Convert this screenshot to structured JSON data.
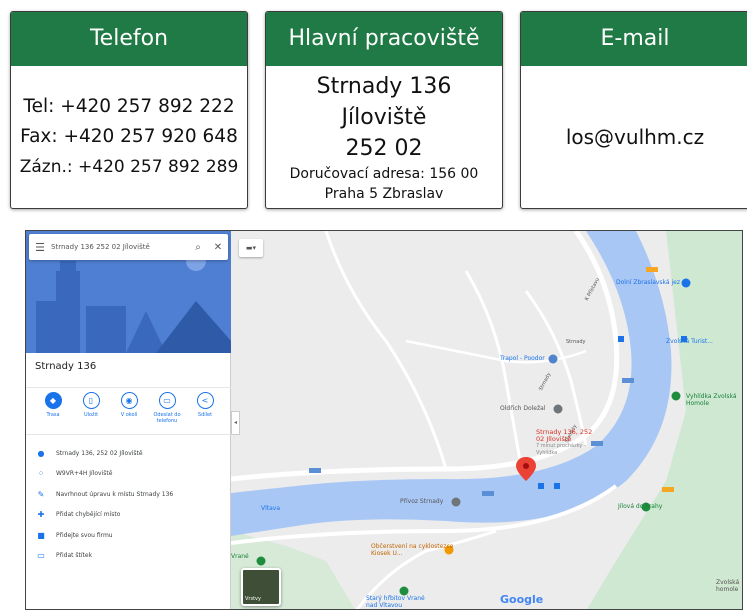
{
  "cards": {
    "phone": {
      "title": "Telefon",
      "tel": "Tel: +420 257 892 222",
      "fax": "Fax: +420 257 920 648",
      "zazn": "Zázn.: +420 257 892 289"
    },
    "workplace": {
      "title": "Hlavní pracoviště",
      "street": "Strnady 136",
      "town": "Jíloviště",
      "zip": "252 02",
      "delivery_line1": "Doručovací adresa: 156 00",
      "delivery_line2": "Praha 5 Zbraslav"
    },
    "email": {
      "title": "E-mail",
      "address": "los@vulhm.cz"
    }
  },
  "map": {
    "search_text": "Strnady 136 252 02 Jíloviště",
    "place_name": "Strnady 136",
    "actions": [
      {
        "label": "Trasa",
        "icon": "directions-icon"
      },
      {
        "label": "Uložit",
        "icon": "bookmark-icon"
      },
      {
        "label": "V okolí",
        "icon": "nearby-icon"
      },
      {
        "label": "Odeslat do telefonu",
        "icon": "phone-send-icon"
      },
      {
        "label": "Sdílet",
        "icon": "share-icon"
      }
    ],
    "info_rows": [
      {
        "text": "Strnady 136, 252 02 Jíloviště",
        "icon": "location-pin-icon"
      },
      {
        "text": "W9VR+4H Jíloviště",
        "icon": "plus-code-icon"
      },
      {
        "text": "Navrhnout úpravu k místu Strnady 136",
        "icon": "edit-pencil-icon"
      },
      {
        "text": "Přidat chybějící místo",
        "icon": "add-place-icon"
      },
      {
        "text": "Přidejte svou firmu",
        "icon": "add-business-icon"
      },
      {
        "text": "Přidat štítek",
        "icon": "label-icon"
      }
    ],
    "labels": {
      "pin": "Strnady 136, 252 02 Jíloviště",
      "pin_sub": "7 minut procházky – Vyhlídka",
      "river": "Vltava",
      "trapol": "Trapol - Poodor",
      "oldrich": "Oldřich Doležal",
      "prevoz": "Přívoz Strnady",
      "jilova": "Jílová do Prahy",
      "obcerstveni": "Občerstvení na cyklostezce Kiosek U...",
      "hrbitov": "Starý hřbitov Vrané nad Vltavou",
      "vyhlidka": "Vyhlídka Zvolská Homole",
      "zvolska": "Zvolská homole",
      "turist": "Zvolská Turist...",
      "prehrada": "Dolní Zbraslavská jez",
      "vranske": "Vrané",
      "road_a": "K Přístavu",
      "road_b": "Strnady",
      "road_c": "Strnady",
      "road_d": "Strnady",
      "google": "Google",
      "layers": "Vrstvy"
    }
  }
}
